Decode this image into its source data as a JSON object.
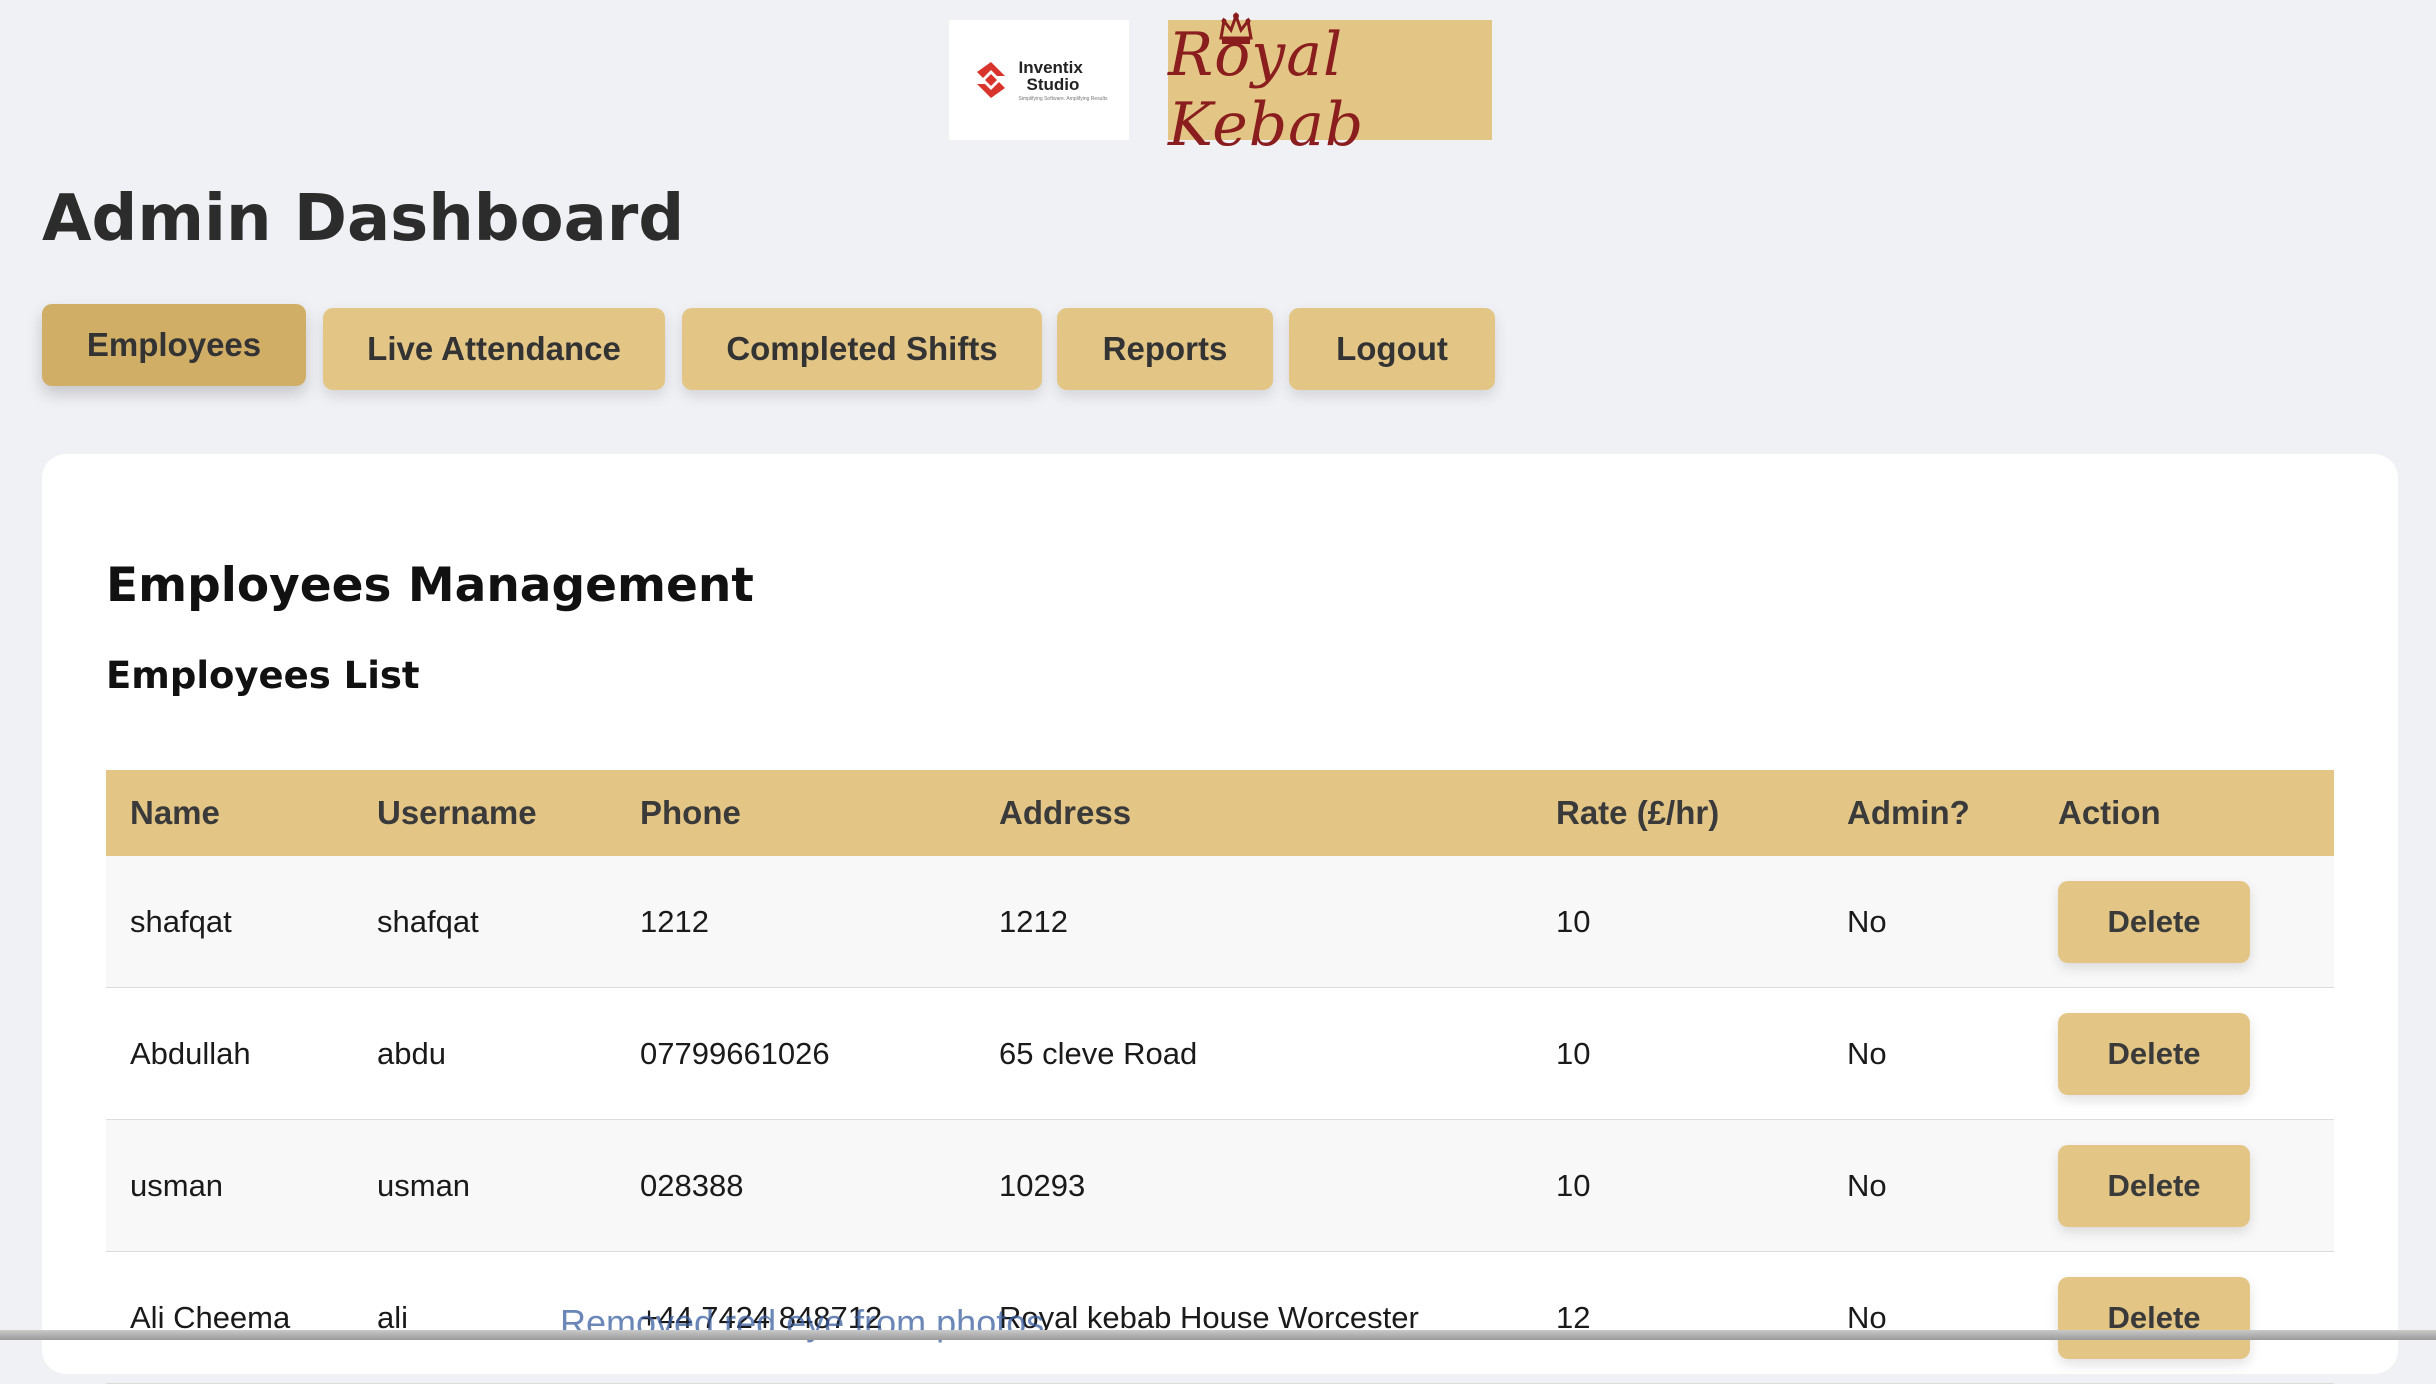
{
  "logos": {
    "inventix_name": "Inventix",
    "inventix_sub": "Studio",
    "inventix_tagline": "Simplifying Software. Amplifying Results",
    "royal_kebab": "Royal Kebab"
  },
  "header": {
    "title": "Admin Dashboard"
  },
  "nav": {
    "employees": "Employees",
    "live_attendance": "Live Attendance",
    "completed_shifts": "Completed Shifts",
    "reports": "Reports",
    "logout": "Logout",
    "active": "Employees"
  },
  "main": {
    "section_title": "Employees Management",
    "list_title": "Employees List",
    "table": {
      "headers": [
        "Name",
        "Username",
        "Phone",
        "Address",
        "Rate (£/hr)",
        "Admin?",
        "Action"
      ],
      "rows": [
        {
          "name": "shafqat",
          "username": "shafqat",
          "phone": "1212",
          "address": "1212",
          "rate": "10",
          "admin": "No",
          "action": "Delete"
        },
        {
          "name": "Abdullah",
          "username": "abdu",
          "phone": "07799661026",
          "address": "65 cleve Road",
          "rate": "10",
          "admin": "No",
          "action": "Delete"
        },
        {
          "name": "usman",
          "username": "usman",
          "phone": "028388",
          "address": "10293",
          "rate": "10",
          "admin": "No",
          "action": "Delete"
        },
        {
          "name": "Ali Cheema",
          "username": "ali",
          "phone": "+44 7424 848712",
          "address": "Royal kebab House Worcester",
          "rate": "12",
          "admin": "No",
          "action": "Delete"
        }
      ]
    }
  },
  "overlay_text": "Removed red eye from photos.",
  "colors": {
    "page_bg": "#f0f1f5",
    "accent": "#e3c685",
    "accent_active": "#d0ae66",
    "brand_red": "#8a1d1d"
  }
}
